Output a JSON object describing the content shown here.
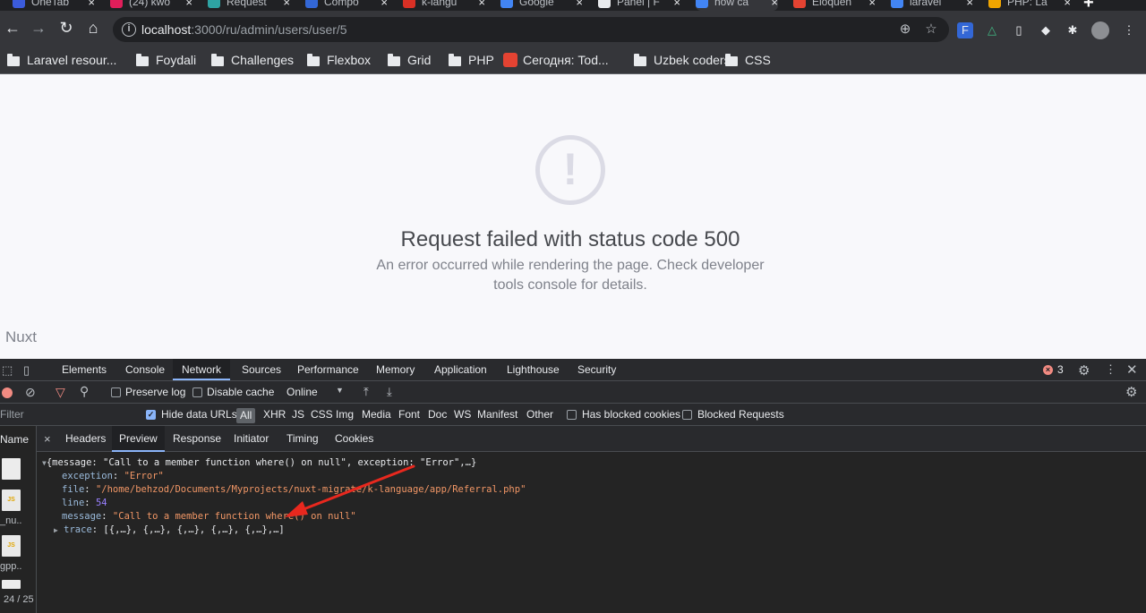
{
  "browser": {
    "tabs": [
      {
        "title": "OneTab",
        "color": "#3b5bdb"
      },
      {
        "title": "(24) kwo",
        "color": "#e01e5a"
      },
      {
        "title": "Request",
        "color": "#2ea3a3"
      },
      {
        "title": "Compo",
        "color": "#3367d6"
      },
      {
        "title": "k-langu",
        "color": "#d93025"
      },
      {
        "title": "Google",
        "color": "#4285f4"
      },
      {
        "title": "Panel | F",
        "color": "#e8eaed"
      },
      {
        "title": "how ca",
        "color": "#4285f4"
      },
      {
        "title": "Eloquen",
        "color": "#e44332"
      },
      {
        "title": "laravel",
        "color": "#4285f4"
      },
      {
        "title": "PHP: La",
        "color": "#f0a500"
      }
    ],
    "tab_close": "×",
    "new_tab": "+",
    "url_host": "localhost",
    "url_rest": ":3000/ru/admin/users/user/5",
    "bookmarks": [
      {
        "label": "Laravel resour...",
        "type": "folder"
      },
      {
        "label": "Foydali",
        "type": "folder"
      },
      {
        "label": "Challenges",
        "type": "folder"
      },
      {
        "label": "Flexbox",
        "type": "folder"
      },
      {
        "label": "Grid",
        "type": "folder"
      },
      {
        "label": "PHP",
        "type": "folder"
      },
      {
        "label": "Сегодня: Tod...",
        "type": "todoist"
      },
      {
        "label": "Uzbek coders",
        "type": "folder"
      },
      {
        "label": "CSS",
        "type": "folder"
      }
    ]
  },
  "page": {
    "error_icon": "!",
    "title": "Request failed with status code 500",
    "description": "An error occurred while rendering the page. Check developer tools console for details.",
    "footer": "Nuxt"
  },
  "devtools": {
    "tabs": [
      "Elements",
      "Console",
      "Network",
      "Sources",
      "Performance",
      "Memory",
      "Application",
      "Lighthouse",
      "Security"
    ],
    "active_tab": "Network",
    "error_count": "3",
    "toolbar": {
      "preserve_log": "Preserve log",
      "disable_cache": "Disable cache",
      "throttle": "Online"
    },
    "filter_bar": {
      "filter_label": "Filter",
      "hide_data_urls": "Hide data URLs",
      "types": [
        "All",
        "XHR",
        "JS",
        "CSS",
        "Img",
        "Media",
        "Font",
        "Doc",
        "WS",
        "Manifest",
        "Other"
      ],
      "has_blocked_cookies": "Has blocked cookies",
      "blocked_requests": "Blocked Requests"
    },
    "request_list": {
      "header": "Name",
      "items": [
        "",
        "_nu..",
        "gpp.."
      ],
      "count": "24 / 25"
    },
    "detail_tabs": [
      "Headers",
      "Preview",
      "Response",
      "Initiator",
      "Timing",
      "Cookies"
    ],
    "active_detail_tab": "Preview",
    "close_glyph": "×",
    "preview": {
      "summary": "{message: \"Call to a member function where() on null\", exception: \"Error\",…}",
      "exception_key": "exception",
      "exception_val": "\"Error\"",
      "file_key": "file",
      "file_val": "\"/home/behzod/Documents/Myprojects/nuxt-migrate/k-language/app/Referral.php\"",
      "line_key": "line",
      "line_val": "54",
      "message_key": "message",
      "message_val": "\"Call to a member function where() on null\"",
      "trace_key": "trace",
      "trace_val": "[{,…}, {,…}, {,…}, {,…}, {,…},…]"
    }
  },
  "colors": {
    "annotation_arrow": "#e8281e",
    "devtools_accent": "#8ab4f8"
  }
}
